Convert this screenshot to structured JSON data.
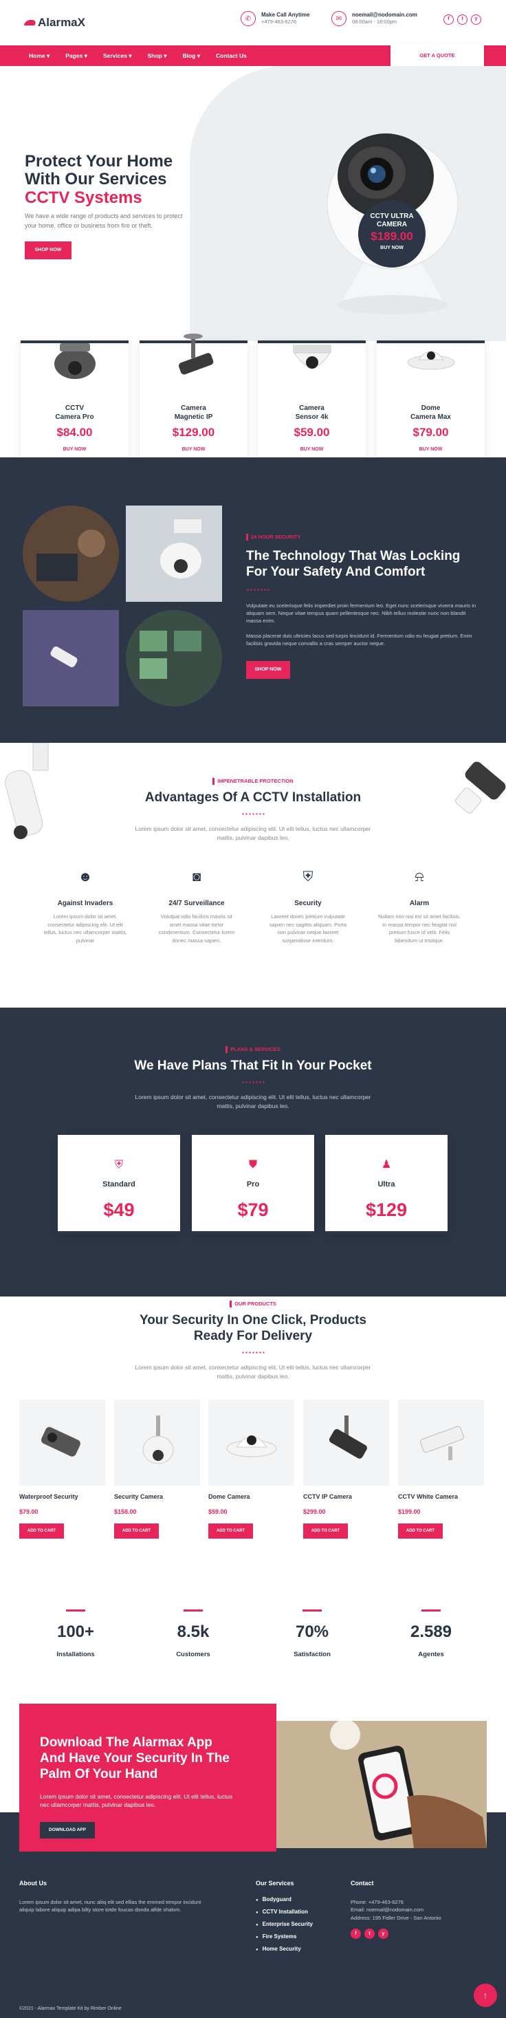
{
  "brand": {
    "name": "AlarmaX",
    "accent": "#e8255a",
    "dark": "#2c3646"
  },
  "topbar": {
    "phone_title": "Make Call Anytime",
    "phone_value": "+479-463-6276",
    "email_title": "noemail@nodomain.com",
    "email_value": "08:00am - 18:00pm",
    "socials": [
      "f",
      "t",
      "y"
    ]
  },
  "nav": {
    "items": [
      "Home",
      "Pages",
      "Services",
      "Shop",
      "Blog",
      "Contact Us"
    ],
    "quote": "GET A QUOTE"
  },
  "hero": {
    "title1": "Protect Your Home",
    "title2": "With Our Services",
    "title3": "CCTV Systems",
    "text": "We have a wide range of products and services to protect your home, office or business from fire or theft.",
    "cta": "SHOP NOW",
    "badge": {
      "title1": "CCTV ULTRA",
      "title2": "CAMERA",
      "price": "$189.00",
      "cta": "BUY NOW"
    }
  },
  "top_products": [
    {
      "name1": "CCTV",
      "name2": "Camera Pro",
      "price": "$84.00",
      "cta": "BUY NOW"
    },
    {
      "name1": "Camera",
      "name2": "Magnetic IP",
      "price": "$129.00",
      "cta": "BUY NOW"
    },
    {
      "name1": "Camera",
      "name2": "Sensor 4k",
      "price": "$59.00",
      "cta": "BUY NOW"
    },
    {
      "name1": "Dome",
      "name2": "Camera Max",
      "price": "$79.00",
      "cta": "BUY NOW"
    }
  ],
  "tech": {
    "eyebrow": "24 HOUR SECURITY",
    "title1": "The Technology That Was Locking",
    "title2": "For Your Safety And Comfort",
    "p1": "Vulputate eu scelerisque felis imperdiet proin fermentum leo. Eget nunc scelerisque viverra mauris in aliquam sem. Neque vitae tempus quam pellentesque nec. Nibh tellus molestie nunc non blandit massa enim.",
    "p2": "Massa placerat duis ultricies lacus sed turpis tincidunt id. Fermentum odio eu feugiat pretium. Enim facilisis gravida neque convallis a cras semper auctor neque.",
    "cta": "SHOP NOW"
  },
  "advantages": {
    "eyebrow": "IMPENETRABLE PROTECTION",
    "title": "Advantages Of A CCTV Installation",
    "text1": "Lorem ipsum dolor sit amet, consectetur adipiscing elit. Ut elit tellus, luctus nec ullamcorper",
    "text2": "mattis, pulvinar dapibus leo.",
    "items": [
      {
        "icon": "thief-icon",
        "title": "Against Invaders",
        "l1": "Lorem ipsum dolor sit amet,",
        "l2": "consectetur adipiscing elit. Ut elit",
        "l3": "tellus, luctus nec ullamcorper mattis,",
        "l4": "pulvinar"
      },
      {
        "icon": "camera-icon",
        "title": "24/7 Surveillance",
        "l1": "Volutpat odio facilisis mauris sit",
        "l2": "amet massa vitae tortor",
        "l3": "condimentum. Consectetur lorem",
        "l4": "donec massa sapien."
      },
      {
        "icon": "shield-icon",
        "title": "Security",
        "l1": "Laoreet donec pretium vulputate",
        "l2": "sapien nec sagittis aliquam. Porta",
        "l3": "non pulvinar neque laoreet",
        "l4": "suspendisse interdum."
      },
      {
        "icon": "alarm-icon",
        "title": "Alarm",
        "l1": "Nullam non nisi est sit amet facilisis.",
        "l2": "In massa tempor nec feugiat nisl",
        "l3": "pretium fusce id velit. Felis",
        "l4": "bibendum ut tristique."
      }
    ]
  },
  "plans": {
    "eyebrow": "PLANS & SERVICES",
    "title": "We Have Plans That Fit In Your Pocket",
    "text1": "Lorem ipsum dolor sit amet, consectetur adipiscing elit. Ut elit tellus, luctus nec ullamcorper",
    "text2": "mattis, pulvinar dapibus leo.",
    "items": [
      {
        "name": "Standard",
        "price": "$49"
      },
      {
        "name": "Pro",
        "price": "$79"
      },
      {
        "name": "Ultra",
        "price": "$129"
      }
    ]
  },
  "products": {
    "eyebrow": "OUR PRODUCTS",
    "title1": "Your Security In One Click, Products",
    "title2": "Ready For Delivery",
    "text1": "Lorem ipsum dolor sit amet, consectetur adipiscing elit. Ut elit tellus, luctus nec ullamcorper",
    "text2": "mattis, pulvinar dapibus leo.",
    "items": [
      {
        "name": "Waterproof Security",
        "price": "$79.00",
        "cta": "ADD TO CART"
      },
      {
        "name": "Security Camera",
        "price": "$158.00",
        "cta": "ADD TO CART"
      },
      {
        "name": "Dome Camera",
        "price": "$59.00",
        "cta": "ADD TO CART"
      },
      {
        "name": "CCTV IP Camera",
        "price": "$299.00",
        "cta": "ADD TO CART"
      },
      {
        "name": "CCTV White Camera",
        "price": "$199.00",
        "cta": "ADD TO CART"
      }
    ]
  },
  "stats": [
    {
      "value": "100+",
      "label": "Installations"
    },
    {
      "value": "8.5k",
      "label": "Customers"
    },
    {
      "value": "70%",
      "label": "Satisfaction"
    },
    {
      "value": "2.589",
      "label": "Agentes"
    }
  ],
  "app": {
    "title1": "Download The Alarmax App",
    "title2": "And Have Your Security In The",
    "title3": "Palm Of Your Hand",
    "text": "Lorem ipsum dolor sit amet, consectetur adipiscing elit. Ut elit tellus, luctus nec ullamcorper mattis, pulvinar dapibus leo.",
    "cta": "DOWNLOAD APP"
  },
  "footer": {
    "about_title": "About Us",
    "about_text": "Lorem ipsum dolor sit amet, nunc aliiq elit sed ellias the emmed tempor incidunt aliquip labore aliquip adipa bilty store totde foucas donda alfde shalom.",
    "services_title": "Our Services",
    "services": [
      "Bodyguard",
      "CCTV Installation",
      "Enterprise Security",
      "Fire Systems",
      "Home Security"
    ],
    "contact_title": "Contact",
    "phone": "Phone: +479-463-6276",
    "email": "Email: noemail@nodomain.com",
    "address": "Address: 195 Fidler Drive - San Antonio",
    "copyright": "©2021 - Alarmax Template Kit by Rimber Online"
  }
}
